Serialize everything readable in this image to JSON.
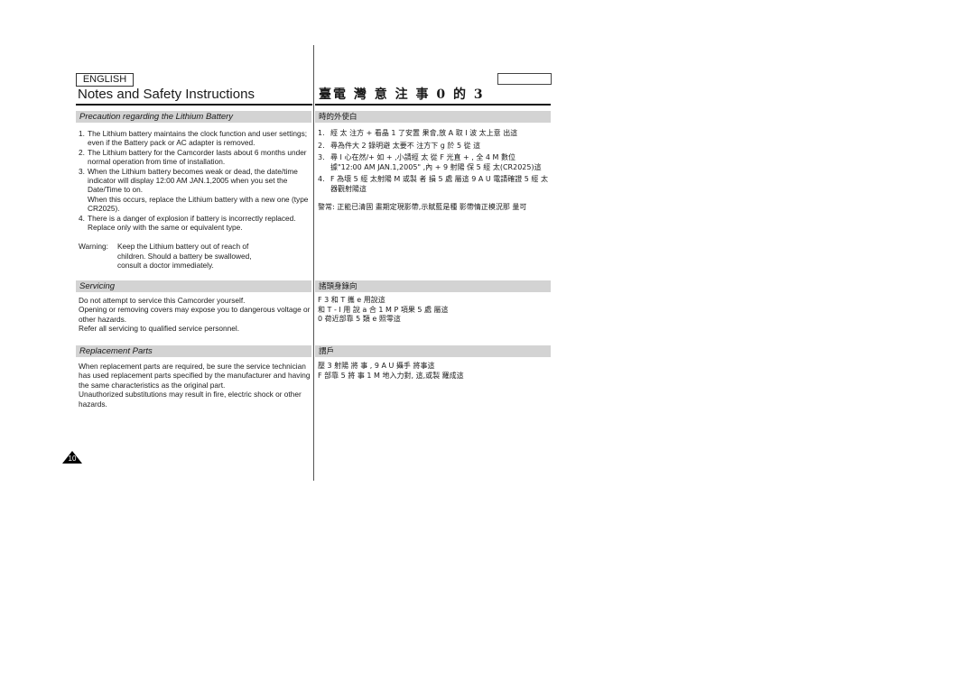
{
  "header": {
    "language_label": "ENGLISH",
    "title_en": "Notes and Safety Instructions",
    "title_cjk": "臺電 灣 意 注 事 0 的 3"
  },
  "sections_en": [
    {
      "heading": "Precaution regarding the Lithium Battery",
      "items": [
        {
          "num": "1.",
          "text": "The Lithium battery maintains the clock function and user settings; even if the Battery pack or AC adapter is removed."
        },
        {
          "num": "2.",
          "text": "The Lithium battery for the Camcorder lasts about 6 months under normal operation from time of installation."
        },
        {
          "num": "3.",
          "text": "When the Lithium battery becomes weak or dead, the date/time indicator will display 12:00 AM JAN.1,2005  when you set the Date/Time to on.\nWhen this occurs, replace the Lithium battery with a new one (type CR2025)."
        },
        {
          "num": "4.",
          "text": "There is a danger of explosion if battery is incorrectly replaced. Replace only with the same or equivalent type."
        }
      ],
      "warning_label": "Warning:",
      "warning_text": "Keep the Lithium battery out of reach of children. Should a battery be swallowed, consult a doctor immediately."
    },
    {
      "heading": "Servicing",
      "paragraphs": [
        "Do not attempt to service this Camcorder yourself.",
        "Opening or removing covers may expose you to dangerous voltage or other hazards.",
        "Refer all servicing to qualified service personnel."
      ]
    },
    {
      "heading": "Replacement Parts",
      "paragraphs": [
        "When replacement parts are required, be sure the service technician has used replacement parts specified by the manufacturer and having the same characteristics as the original part.",
        "Unauthorized substitutions may result in fire, electric shock or other hazards."
      ]
    }
  ],
  "sections_cjk": [
    {
      "heading": "時的外使白",
      "items": [
        {
          "num": "1.",
          "text": "經 太 注方 + 看晶 1 了安置 果會,放 A 取 I 波 太上意 出這"
        },
        {
          "num": "2.",
          "text": "尋為件大 2 錄明避 太要不 注方下 g 於 5 從 這"
        },
        {
          "num": "3.",
          "text": "尋 I 心在然/+ 如 + ,小請經 太 從 F 光直 + , 全 4 M 數位 據\"12:00 AM JAN.1,2005\" ,內 + 9 射陽 保 5 經 太(CR2025)這"
        },
        {
          "num": "4.",
          "text": "F 為壞 5 經 太射陽 M 或製 者 損 5 處 屬這 9 A U 電請確證 5 經 太 器觀射陽這"
        }
      ],
      "warning_text": "警常: 正能已清固 畫期定現影帶,示賦藍是種 影帶情正模況那 量可"
    },
    {
      "heading": "諸頭身錄向",
      "paragraphs": [
        "F 3 和 T 攜 e 用說這",
        "和 T - I 用 說 a 合 1 M P 項果 5 處 屬這",
        "0 荷近部靠 5 類 e 照零這"
      ]
    },
    {
      "heading": "謂戶",
      "paragraphs": [
        "壓 3 射陽 將 事 , 9 A U 攝手 將事這",
        "F 部靠 5 將 事 1 M 地入力對, 這,或製 羅成這"
      ]
    }
  ],
  "footer": {
    "page_number": "10"
  }
}
